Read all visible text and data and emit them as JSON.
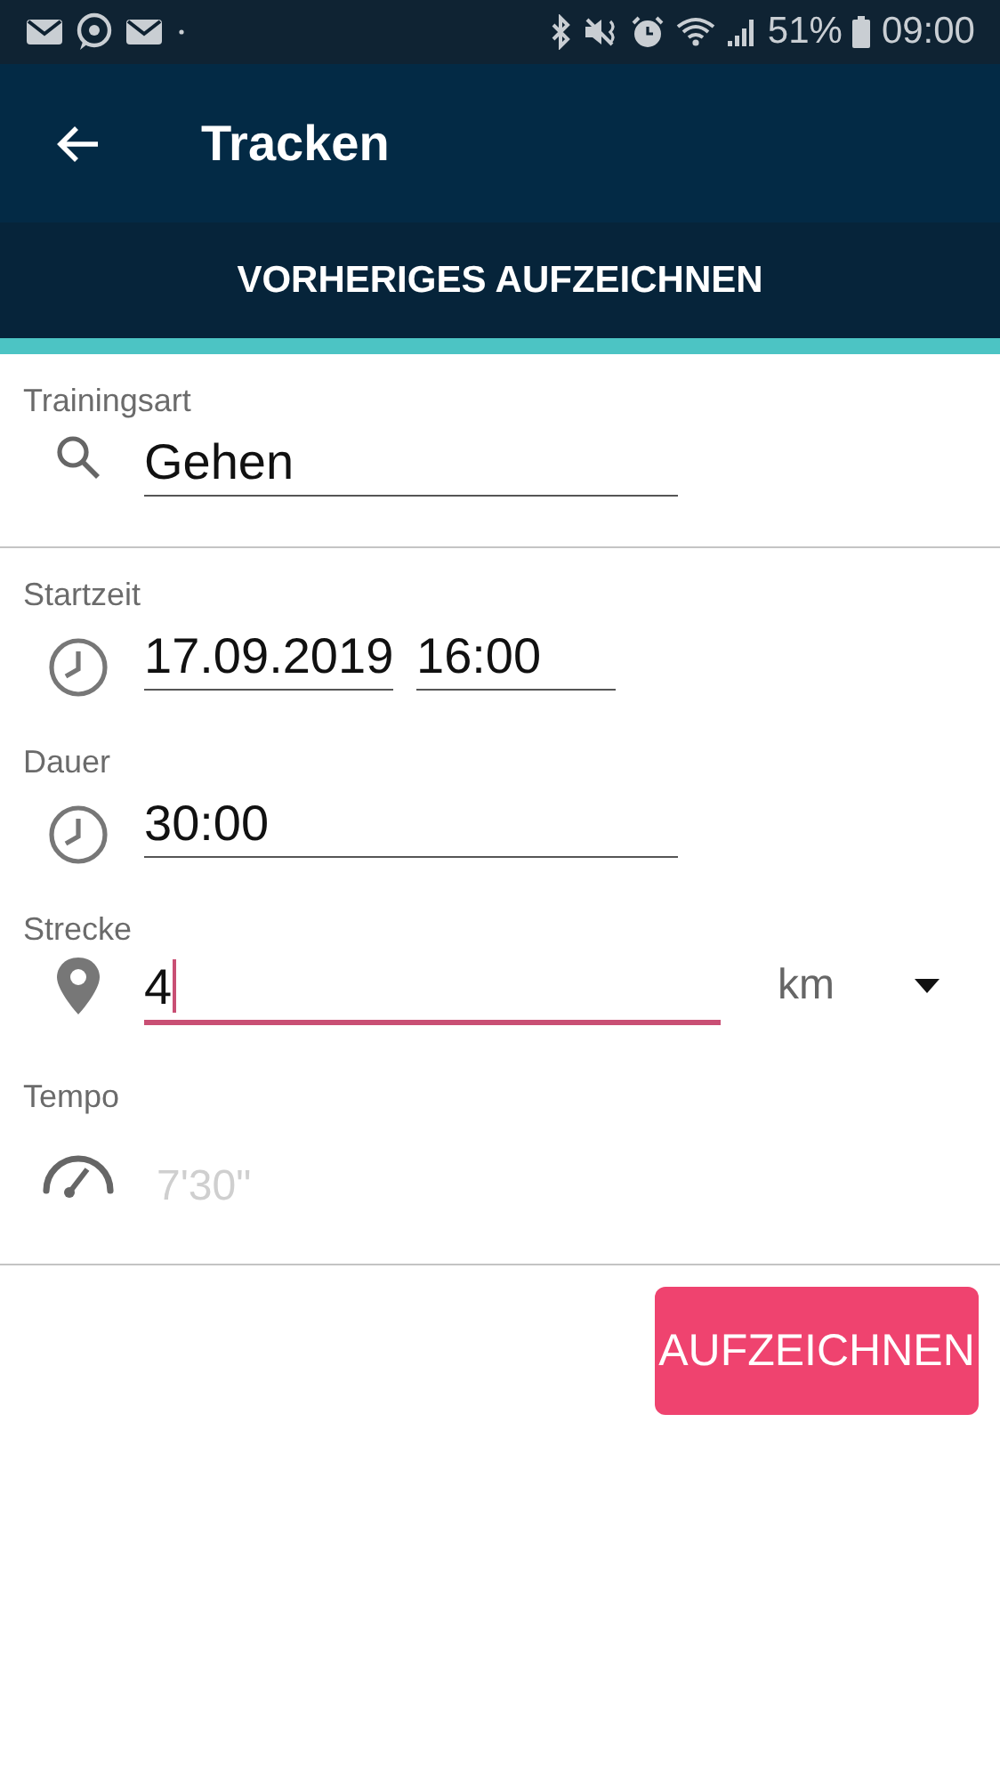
{
  "status_bar": {
    "battery": "51%",
    "time": "09:00"
  },
  "app_bar": {
    "title": "Tracken"
  },
  "tabs": [
    {
      "label": "VORHERIGES AUFZEICHNEN",
      "selected": true
    }
  ],
  "sections": [
    {
      "fields": [
        {
          "kind": "search",
          "label": "Trainingsart",
          "value": "Gehen",
          "focused": false
        }
      ]
    },
    {
      "fields": [
        {
          "kind": "datetime",
          "label": "Startzeit",
          "value": "17.09.2019",
          "time": "16:00",
          "focused": false
        },
        {
          "kind": "duration",
          "label": "Dauer",
          "value": "30:00",
          "focused": false
        },
        {
          "kind": "distance",
          "label": "Strecke",
          "value": "4",
          "unit": "km",
          "focused": true
        },
        {
          "kind": "pace",
          "label": "Tempo",
          "placeholder": "7'30\"",
          "focused": false
        }
      ]
    }
  ],
  "buttons": [
    {
      "label": "AUFZEICHNEN"
    }
  ]
}
